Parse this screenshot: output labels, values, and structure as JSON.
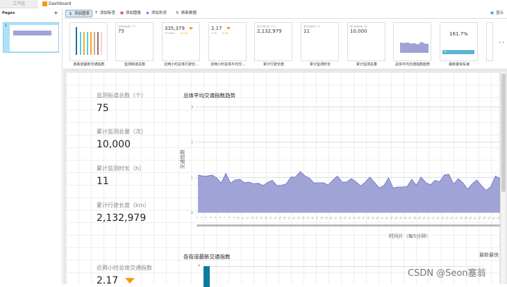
{
  "tabs": [
    {
      "label": "工作区"
    },
    {
      "label": "Dashboard"
    }
  ],
  "sidebar": {
    "title": "Pages",
    "add": "+",
    "page_number": "1"
  },
  "toolbar": {
    "add_chart": "添加图表",
    "add_label": "添加标签",
    "add_image": "添加图像",
    "add_shape": "添加形状",
    "refresh": "刷新数据",
    "display": "显示"
  },
  "thumbnails": [
    {
      "label": "各街道最新交通指数",
      "type": "bar"
    },
    {
      "label": "监测街道总数",
      "small": "监测街道总数（个）",
      "value": "75"
    },
    {
      "label": "近两小时总体行驶长...",
      "value": "335,379",
      "prev": "375,843",
      "change": "-10.5%"
    },
    {
      "label": "近两小时总体平均交...",
      "value": "2.17",
      "prev": "2.35",
      "change": "-8.66"
    },
    {
      "label": "累计行驶长度",
      "small": "累计行驶长度（km）",
      "value": "2,132,979"
    },
    {
      "label": "累计监测时长",
      "small": "累计监测时长（h）",
      "value": "11"
    },
    {
      "label": "累计监测总量",
      "small": "累计监测总量（次）",
      "value": "10,000"
    },
    {
      "label": "总体平均交通指数趋势",
      "type": "area"
    },
    {
      "label": "最新最快车速",
      "value": "161.7%",
      "bar_value": "60"
    }
  ],
  "kpis": [
    {
      "label": "监测街道总数（个）",
      "value": "75"
    },
    {
      "label": "累计监测总量（次）",
      "value": "10,000"
    },
    {
      "label": "累计监测时长（h）",
      "value": "11"
    },
    {
      "label": "累计行驶长度（km）",
      "value": "2,132,979"
    },
    {
      "label": "近两小时总体交通指数",
      "value": "2.17"
    }
  ],
  "bar_chart": {
    "title": "各街道最新交通指数",
    "ytick_top": "4"
  },
  "cut_title": "最新最快",
  "watermark": "CSDN @Seon塞翁",
  "colors": {
    "area": "#9fa3d6",
    "line": "#6d72c3",
    "bar": "#0e7aa0",
    "orange": "#f39c12"
  },
  "chart_data": {
    "type": "area",
    "title": "总体平均交通指数趋势",
    "xlabel": "时间片（每5分钟）",
    "ylabel": "交通指数",
    "ylim": [
      0,
      3
    ],
    "yticks": [
      "0",
      "1",
      "2",
      "3"
    ],
    "x": [
      1,
      2,
      3,
      4,
      5,
      6,
      7,
      8,
      9,
      10,
      11,
      12,
      13,
      14,
      15,
      16,
      17,
      18,
      19,
      20,
      21,
      22,
      23,
      24,
      25,
      26,
      27,
      28,
      29,
      30,
      31,
      32,
      33,
      34,
      35,
      36,
      37,
      38,
      39,
      40,
      41,
      42,
      43,
      44,
      45,
      46,
      47,
      48,
      49,
      50,
      51,
      52,
      53,
      54,
      55,
      56,
      57,
      58,
      59,
      60,
      61,
      62,
      63,
      64,
      65,
      66
    ],
    "values": [
      1.07,
      1.04,
      1.04,
      1.07,
      0.99,
      0.84,
      1.12,
      0.84,
      0.93,
      0.95,
      0.85,
      0.87,
      0.82,
      0.84,
      0.77,
      0.86,
      0.92,
      0.77,
      0.78,
      0.82,
      1.01,
      1.01,
      1.17,
      1.05,
      0.98,
      0.84,
      0.85,
      0.85,
      0.79,
      0.92,
      1.04,
      0.87,
      0.87,
      0.97,
      0.88,
      0.76,
      0.87,
      1.01,
      0.86,
      0.7,
      0.77,
      0.99,
      0.7,
      0.73,
      0.73,
      0.74,
      0.95,
      0.78,
      1.01,
      0.86,
      0.79,
      0.92,
      0.88,
      1.07,
      1.09,
      0.81,
      0.97,
      0.85,
      0.67,
      0.82,
      0.93,
      0.77,
      0.63,
      0.74,
      1.04,
      0.97
    ]
  }
}
